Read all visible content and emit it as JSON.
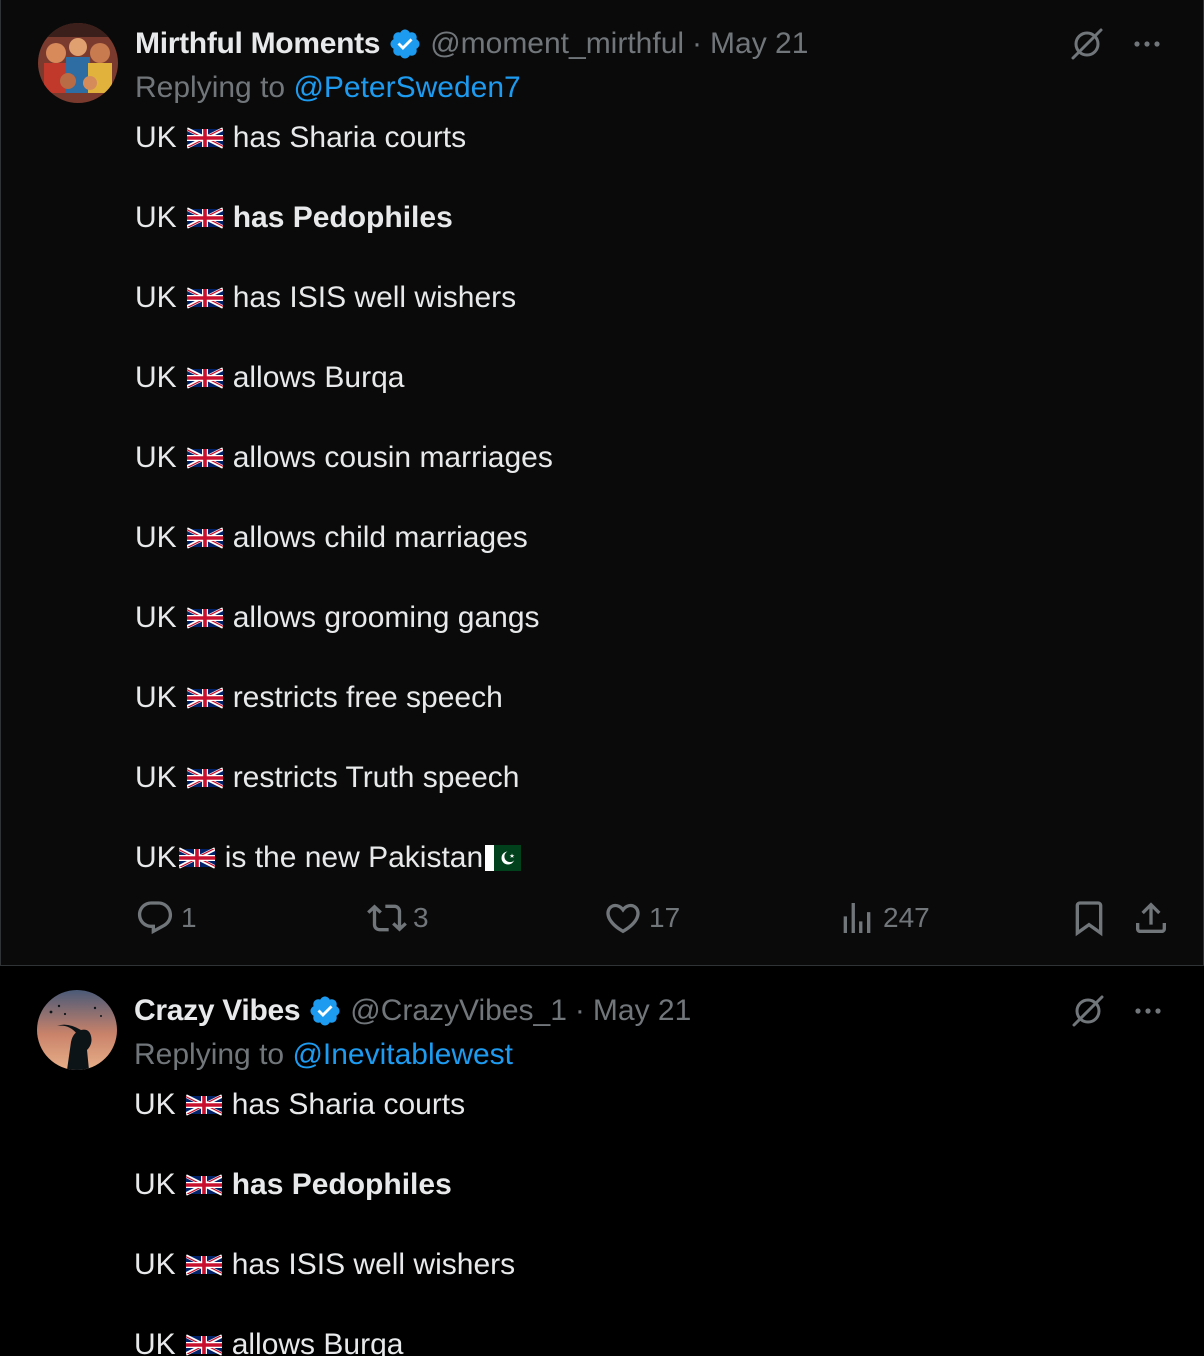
{
  "tweets": [
    {
      "name": "Mirthful Moments",
      "handle": "@moment_mirthful",
      "separator": "·",
      "date": "May 21",
      "replying_prefix": "Replying to ",
      "replying_to": "@PeterSweden7",
      "lines": [
        {
          "prefix": "UK",
          "text": "has Sharia courts",
          "bold": false
        },
        {
          "prefix": "UK",
          "text": "has Pedophiles",
          "bold": true
        },
        {
          "prefix": "UK",
          "text": "has ISIS well wishers",
          "bold": false
        },
        {
          "prefix": "UK",
          "text": "allows Burqa",
          "bold": false
        },
        {
          "prefix": "UK",
          "text": "allows cousin marriages",
          "bold": false
        },
        {
          "prefix": "UK",
          "text": "allows child marriages",
          "bold": false
        },
        {
          "prefix": "UK",
          "text": "allows grooming gangs",
          "bold": false
        },
        {
          "prefix": "UK",
          "text": "restricts free speech",
          "bold": false
        },
        {
          "prefix": "UK",
          "text": "restricts Truth speech",
          "bold": false
        },
        {
          "prefix": "UK",
          "text": "is the new Pakistan",
          "bold": false
        }
      ],
      "actions": {
        "replies": "1",
        "retweets": "3",
        "likes": "17",
        "views": "247"
      }
    },
    {
      "name": "Crazy Vibes",
      "handle": "@CrazyVibes_1",
      "separator": "·",
      "date": "May 21",
      "replying_prefix": "Replying to ",
      "replying_to": "@Inevitablewest",
      "lines": [
        {
          "prefix": "UK",
          "text": "has Sharia courts",
          "bold": false
        },
        {
          "prefix": "UK",
          "text": "has Pedophiles",
          "bold": true
        },
        {
          "prefix": "UK",
          "text": "has ISIS well wishers",
          "bold": false
        },
        {
          "prefix": "UK",
          "text": "allows Burqa",
          "bold": false
        }
      ]
    }
  ],
  "icons": {
    "verified": "verified-badge-icon",
    "grok": "grok-icon",
    "more": "more-icon",
    "reply": "reply-icon",
    "retweet": "retweet-icon",
    "like": "heart-icon",
    "views": "views-icon",
    "bookmark": "bookmark-icon",
    "share": "share-icon"
  },
  "colors": {
    "background": "#000000",
    "text": "#e7e9ea",
    "secondary": "#71767b",
    "link": "#1d9bf0",
    "verified": "#1d9bf0"
  }
}
